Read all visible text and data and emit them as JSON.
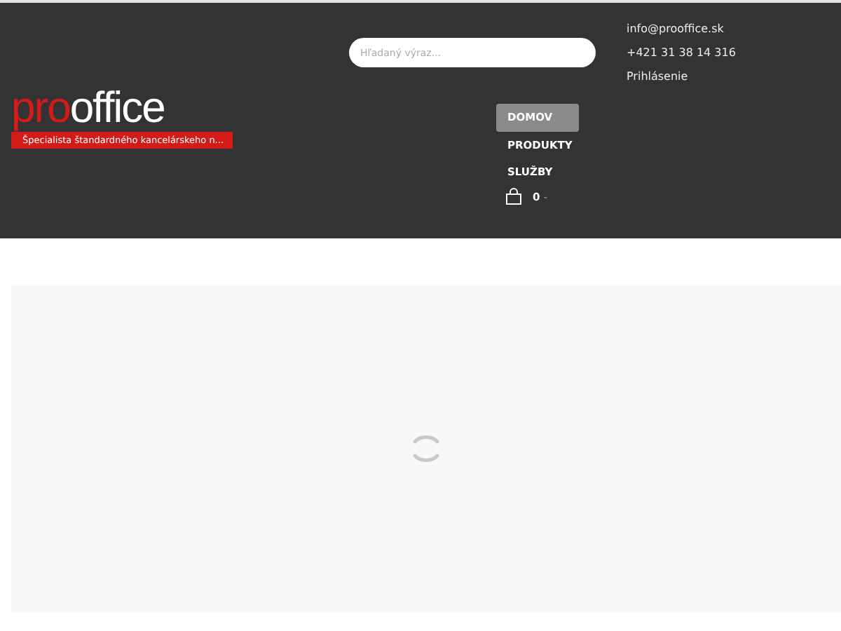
{
  "logo": {
    "accent": "pro",
    "name": "office",
    "tagline": "Špecialista štandardného kancelárskeho n..."
  },
  "search": {
    "placeholder": "Hľadaný výraz..."
  },
  "contact": [
    "info@prooffice.sk",
    "+421 31 38 14 316",
    "Prihlásenie"
  ],
  "nav": [
    {
      "label": "DOMOV",
      "selected": true
    },
    {
      "label": "PRODUKTY",
      "selected": false
    },
    {
      "label": "SLUŽBY",
      "selected": false
    }
  ],
  "cart": {
    "count": "0",
    "suffix": "-"
  }
}
